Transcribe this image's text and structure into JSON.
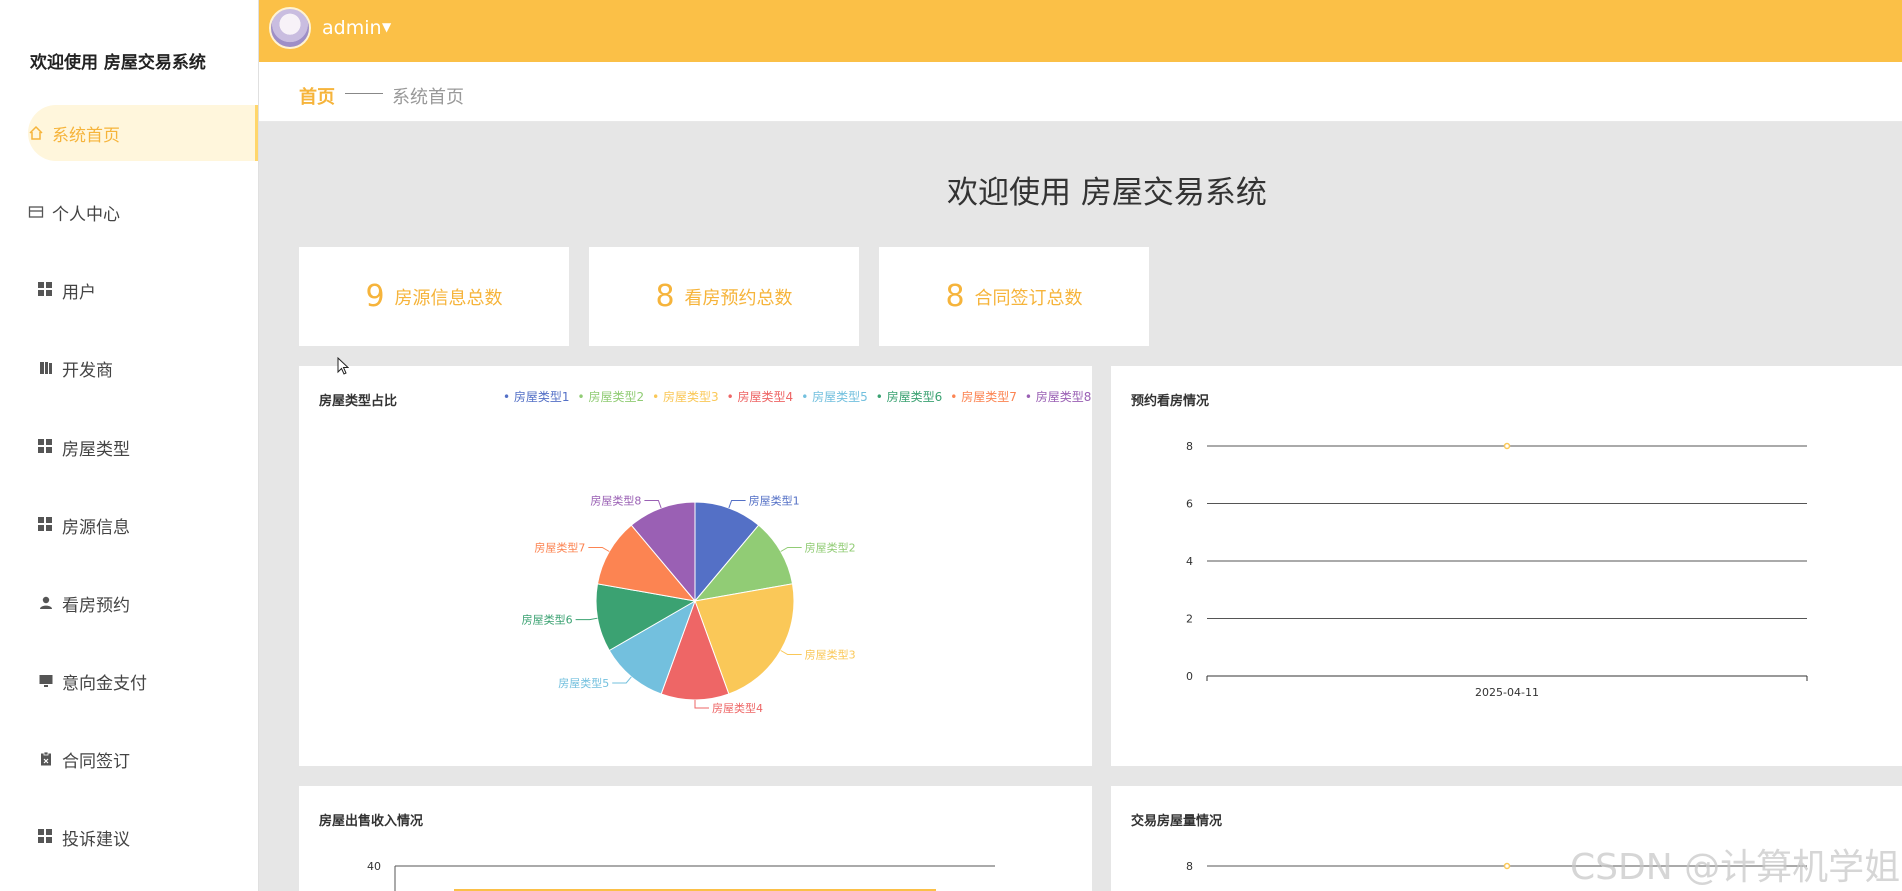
{
  "sidebar": {
    "brand": "欢迎使用 房屋交易系统",
    "items": [
      {
        "label": "系统首页",
        "icon": "home-icon",
        "active": true
      },
      {
        "label": "个人中心",
        "icon": "card-icon"
      },
      {
        "label": "用户",
        "icon": "grid-icon"
      },
      {
        "label": "开发商",
        "icon": "book-icon"
      },
      {
        "label": "房屋类型",
        "icon": "grid-icon"
      },
      {
        "label": "房源信息",
        "icon": "grid-icon"
      },
      {
        "label": "看房预约",
        "icon": "user-icon"
      },
      {
        "label": "意向金支付",
        "icon": "monitor-icon"
      },
      {
        "label": "合同签订",
        "icon": "clipboard-icon"
      },
      {
        "label": "投诉建议",
        "icon": "grid-icon"
      }
    ]
  },
  "topbar": {
    "username": "admin",
    "caret": "▼"
  },
  "breadcrumb": {
    "home": "首页",
    "current": "系统首页"
  },
  "welcome": "欢迎使用 房屋交易系统",
  "stats": [
    {
      "value": "9",
      "label": "房源信息总数"
    },
    {
      "value": "8",
      "label": "看房预约总数"
    },
    {
      "value": "8",
      "label": "合同签订总数"
    }
  ],
  "panels": {
    "pie_title": "房屋类型占比",
    "appointments_title": "预约看房情况",
    "sales_title": "房屋出售收入情况",
    "volume_title": "交易房屋量情况"
  },
  "colors": {
    "accent": "#fbc047",
    "accent_text": "#f6b43b"
  },
  "watermark": "CSDN @计算机学姐",
  "chart_data": [
    {
      "type": "pie",
      "title": "房屋类型占比",
      "categories": [
        "房屋类型1",
        "房屋类型2",
        "房屋类型3",
        "房屋类型4",
        "房屋类型5",
        "房屋类型6",
        "房屋类型7",
        "房屋类型8"
      ],
      "values": [
        1,
        1,
        2,
        1,
        1,
        1,
        1,
        1
      ],
      "colors": [
        "#5470c6",
        "#91cc75",
        "#fac858",
        "#ee6666",
        "#73c0de",
        "#3ba272",
        "#fc8452",
        "#9a60b4"
      ],
      "legend": "top-right"
    },
    {
      "type": "line",
      "title": "预约看房情况",
      "x": [
        "2025-04-11"
      ],
      "values": [
        8
      ],
      "ylim": [
        0,
        8
      ],
      "yticks": [
        "0",
        "2",
        "4",
        "6",
        "8"
      ],
      "grid": true
    },
    {
      "type": "bar",
      "title": "房屋出售收入情况",
      "yticks_visible": [
        "40"
      ],
      "grid": true
    },
    {
      "type": "line",
      "title": "交易房屋量情况",
      "yticks_visible": [
        "8"
      ],
      "grid": true
    }
  ]
}
